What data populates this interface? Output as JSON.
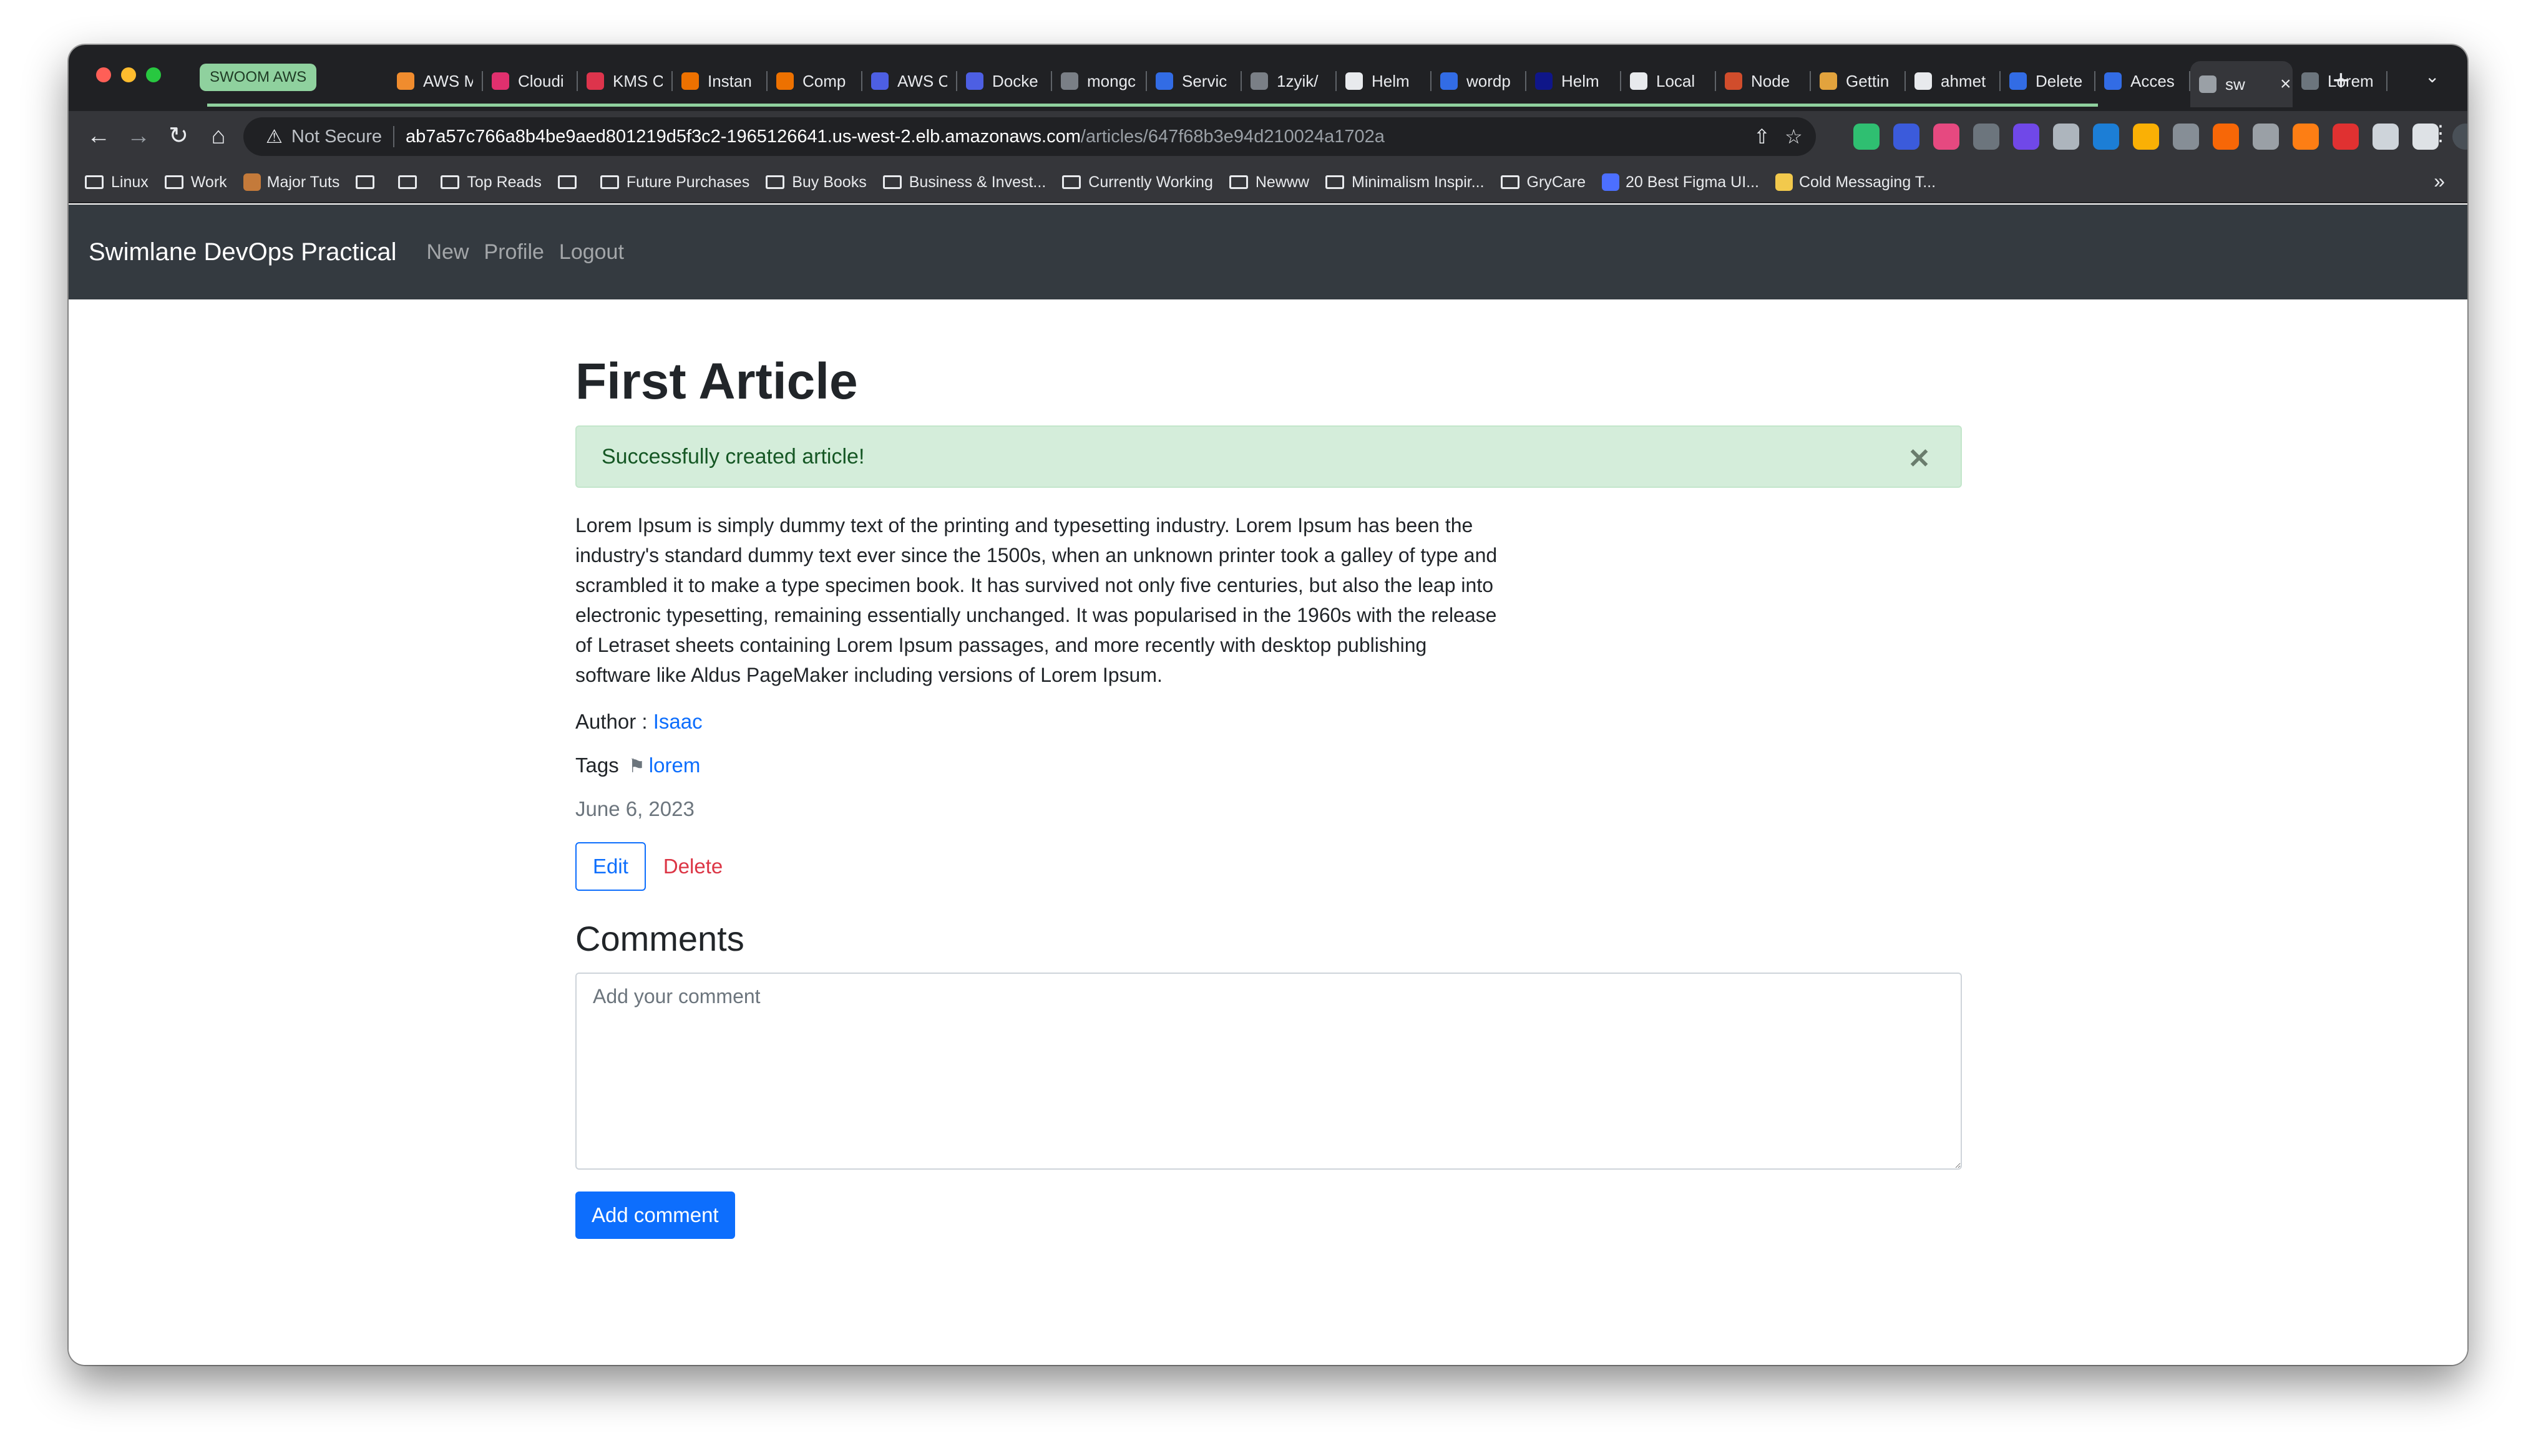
{
  "browser": {
    "tab_group_label": "SWOOM AWS",
    "tabs": [
      {
        "label": "AWS M",
        "color": "#f08c2e"
      },
      {
        "label": "Cloudi",
        "color": "#e0306e"
      },
      {
        "label": "KMS C",
        "color": "#dd344c"
      },
      {
        "label": "Instan",
        "color": "#ed7100"
      },
      {
        "label": "Comp",
        "color": "#ed7100"
      },
      {
        "label": "AWS C",
        "color": "#4d5fe3"
      },
      {
        "label": "Docke",
        "color": "#4d5fe3"
      },
      {
        "label": "mongc",
        "color": "#7a7f86"
      },
      {
        "label": "Servic",
        "color": "#326ce5"
      },
      {
        "label": "1zyik/",
        "color": "#7a7f86"
      },
      {
        "label": "Helm",
        "color": "#e8eaed"
      },
      {
        "label": "wordp",
        "color": "#326ce5"
      },
      {
        "label": "Helm",
        "color": "#0f1689"
      },
      {
        "label": "Local",
        "color": "#e8eaed"
      },
      {
        "label": "Node",
        "color": "#d14d2c"
      },
      {
        "label": "Gettin",
        "color": "#e2a33d"
      },
      {
        "label": "ahmet",
        "color": "#e8eaed"
      },
      {
        "label": "Delete",
        "color": "#326ce5"
      },
      {
        "label": "Acces",
        "color": "#326ce5"
      },
      {
        "label": "sw",
        "color": "#9aa0a6",
        "active": true
      },
      {
        "label": "Lorem",
        "color": "#6c757d"
      }
    ],
    "address": {
      "security_label": "Not Secure",
      "host": "ab7a57c766a8b4be9aed801219d5f3c2-1965126641.us-west-2.elb.amazonaws.com",
      "path": "/articles/647f68b3e94d210024a1702a"
    },
    "bookmarks": [
      {
        "label": "Linux",
        "type": "folder"
      },
      {
        "label": "Work",
        "type": "folder"
      },
      {
        "label": "Major Tuts",
        "type": "favicon",
        "color": "#c47a3a"
      },
      {
        "label": "",
        "type": "folder"
      },
      {
        "label": "",
        "type": "folder"
      },
      {
        "label": "Top Reads",
        "type": "folder"
      },
      {
        "label": "",
        "type": "folder"
      },
      {
        "label": "Future Purchases",
        "type": "folder"
      },
      {
        "label": "Buy Books",
        "type": "folder"
      },
      {
        "label": "Business & Invest...",
        "type": "folder"
      },
      {
        "label": "Currently Working",
        "type": "folder"
      },
      {
        "label": "Newww",
        "type": "folder"
      },
      {
        "label": "Minimalism Inspir...",
        "type": "folder"
      },
      {
        "label": "GryCare",
        "type": "folder"
      },
      {
        "label": "20 Best Figma UI...",
        "type": "favicon",
        "color": "#4c6fff"
      },
      {
        "label": "Cold Messaging T...",
        "type": "favicon",
        "color": "#f2c94c"
      }
    ]
  },
  "site": {
    "brand": "Swimlane DevOps Practical",
    "nav": [
      "New",
      "Profile",
      "Logout"
    ]
  },
  "article": {
    "title": "First Article",
    "alert": "Successfully created article!",
    "body": "Lorem Ipsum is simply dummy text of the printing and typesetting industry. Lorem Ipsum has been the industry's standard dummy text ever since the 1500s, when an unknown printer took a galley of type and scrambled it to make a type specimen book. It has survived not only five centuries, but also the leap into electronic typesetting, remaining essentially unchanged. It was popularised in the 1960s with the release of Letraset sheets containing Lorem Ipsum passages, and more recently with desktop publishing software like Aldus PageMaker including versions of Lorem Ipsum.",
    "author_label": "Author :",
    "author": "Isaac",
    "tags_label": "Tags",
    "tag": "lorem",
    "date": "June 6, 2023",
    "edit_label": "Edit",
    "delete_label": "Delete"
  },
  "comments": {
    "heading": "Comments",
    "placeholder": "Add your comment",
    "value": "",
    "submit_label": "Add comment"
  },
  "colors": {
    "navbar": "#343a40",
    "primary": "#0d6efd",
    "danger": "#dc3545",
    "success_bg": "#d4edda",
    "tab_group": "#8fd19e"
  }
}
